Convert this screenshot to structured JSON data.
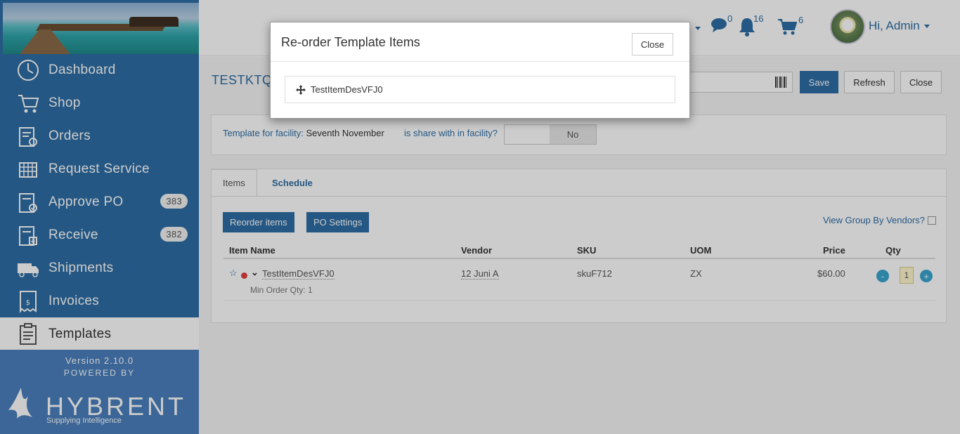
{
  "sidebar": {
    "items": [
      {
        "label": "Dashboard",
        "icon": "dashboard-icon",
        "badge": ""
      },
      {
        "label": "Shop",
        "icon": "cart-icon",
        "badge": ""
      },
      {
        "label": "Orders",
        "icon": "orders-icon",
        "badge": ""
      },
      {
        "label": "Request Service",
        "icon": "request-service-icon",
        "badge": ""
      },
      {
        "label": "Approve PO",
        "icon": "approve-po-icon",
        "badge": "383"
      },
      {
        "label": "Receive",
        "icon": "receive-icon",
        "badge": "382"
      },
      {
        "label": "Shipments",
        "icon": "truck-icon",
        "badge": ""
      },
      {
        "label": "Invoices",
        "icon": "invoice-icon",
        "badge": ""
      },
      {
        "label": "Templates",
        "icon": "templates-icon",
        "badge": ""
      }
    ],
    "version": "Version 2.10.0",
    "powered_by": "POWERED BY",
    "logo_word": "HYBRENT",
    "logo_tagline": "Supplying Intelligence"
  },
  "topbar": {
    "messages_count": "0",
    "notifications_count": "16",
    "cart_count": "6",
    "greeting": "Hi, Admin"
  },
  "page": {
    "title": "TESTKTQK",
    "buttons": {
      "save": "Save",
      "refresh": "Refresh",
      "close": "Close"
    },
    "facility_label": "Template for facility:",
    "facility_value": "Seventh November",
    "share_label": "is share with in facility?",
    "share_value": "No",
    "tabs": [
      {
        "label": "Items"
      },
      {
        "label": "Schedule"
      }
    ],
    "reorder_btn": "Reorder items",
    "po_settings_btn": "PO Settings",
    "view_group": "View Group By Vendors?",
    "columns": [
      "Item Name",
      "Vendor",
      "SKU",
      "UOM",
      "Price",
      "Qty"
    ],
    "row": {
      "item_name": "TestItemDesVFJ0",
      "min_order": "Min Order Qty: 1",
      "vendor": "12 Juni A",
      "sku": "skuF712",
      "uom": "ZX",
      "price": "$60.00",
      "qty": "1"
    }
  },
  "modal": {
    "title": "Re-order Template Items",
    "close_label": "Close",
    "items": [
      "TestItemDesVFJ0"
    ]
  },
  "colors": {
    "primary": "#2e6da4",
    "sidebar": "#2e6da4",
    "badge_qty": "#3aa6d0"
  }
}
